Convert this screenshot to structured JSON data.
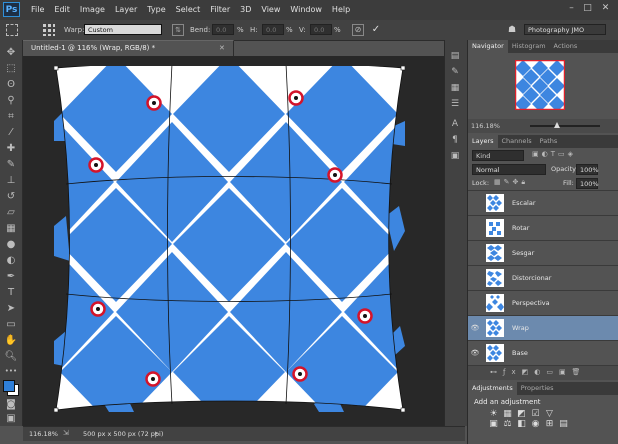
{
  "app": {
    "logo": "Ps"
  },
  "menu": [
    "File",
    "Edit",
    "Image",
    "Layer",
    "Type",
    "Select",
    "Filter",
    "3D",
    "View",
    "Window",
    "Help"
  ],
  "window_buttons": [
    "–",
    "□",
    "✕"
  ],
  "options": {
    "warp_label": "Warp:",
    "warp_value": "Custom",
    "bend_label": "Bend:",
    "bend_value": "0.0",
    "h_label": "H:",
    "h_value": "0.0",
    "v_label": "V:",
    "v_value": "0.0",
    "percent": "%",
    "workspace": "Photography JMO"
  },
  "document": {
    "tab_title": "Untitled-1 @ 116% (Wrap, RGB/8) *",
    "zoom": "116.18%",
    "info": "500 px x 500 px (72 ppi)"
  },
  "navigator": {
    "tabs": [
      "Navigator",
      "Histogram",
      "Actions"
    ],
    "zoom": "116.18%"
  },
  "layers_panel": {
    "tabs": [
      "Layers",
      "Channels",
      "Paths"
    ],
    "filter_kind": "Kind",
    "blend_mode": "Normal",
    "opacity_label": "Opacity:",
    "opacity_value": "100%",
    "lock_label": "Lock:",
    "fill_label": "Fill:",
    "fill_value": "100%",
    "layers": [
      {
        "name": "Escalar",
        "visible": false,
        "selected": false
      },
      {
        "name": "Rotar",
        "visible": false,
        "selected": false
      },
      {
        "name": "Sesgar",
        "visible": false,
        "selected": false
      },
      {
        "name": "Distorcionar",
        "visible": false,
        "selected": false
      },
      {
        "name": "Perspectiva",
        "visible": false,
        "selected": false
      },
      {
        "name": "Wrap",
        "visible": true,
        "selected": true
      },
      {
        "name": "Base",
        "visible": true,
        "selected": false
      }
    ]
  },
  "adjustments": {
    "tabs": [
      "Adjustments",
      "Properties"
    ],
    "heading": "Add an adjustment",
    "row1": [
      "☀",
      "▦",
      "◩",
      "☑",
      "▽"
    ],
    "row2": [
      "▣",
      "⚖",
      "◧",
      "◉",
      "⊞",
      "▤"
    ],
    "row3": [
      "◪",
      "◫",
      "▥",
      "◨",
      "◼"
    ]
  },
  "colors": {
    "accent": "#2f7fd8",
    "pattern_blue": "#3d86e0",
    "marker_red": "#d4142a",
    "layer_selected": "#6c8aae"
  }
}
